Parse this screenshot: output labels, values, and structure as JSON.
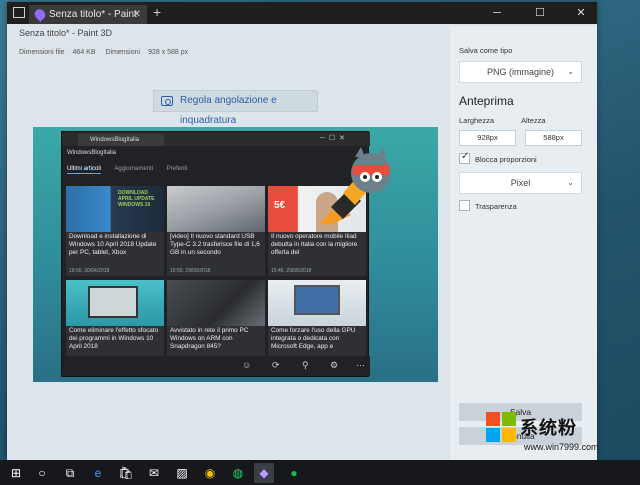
{
  "window": {
    "tab_title": "Senza titolo* - Paint 3D",
    "page_title": "Senza titolo* - Paint 3D",
    "file_size_label": "Dimensioni file",
    "file_size": "464 KB",
    "dimensions_label": "Dimensioni",
    "dimensions": "928 x 588 px"
  },
  "toolbar": {
    "crop_button": "Regola angolazione e inquadratura"
  },
  "preview": {
    "tab_title": "WindowsBlogItalia",
    "header": "WindowsBlogItalia",
    "nav": [
      "Ultimi articoli",
      "Aggiornamenti",
      "Preferiti"
    ],
    "cards": [
      {
        "title": "Download e installazione di Windows 10 April 2018 Update per PC, tablet, Xbox",
        "date": "19:00, 30/04/2018",
        "banner": "DOWNLOAD APRIL UPDATE WINDOWS 10"
      },
      {
        "title": "[video] Il nuovo standard USB Type-C 3.2 trasferisce file di 1,6 GB in un secondo",
        "date": "15:50, 29/09/2018",
        "banner": ""
      },
      {
        "title": "Il nuovo operatore mobile Iliad debutta in Italia con la migliore offerta del",
        "date": "15:45, 29/05/2018",
        "banner": "5€"
      },
      {
        "title": "Come eliminare l'effetto sfocato dei programmi in Windows 10 April 2018",
        "date": "",
        "banner": ""
      },
      {
        "title": "Avvistato in rete il primo PC Windows on ARM con Snapdragon 845?",
        "date": "",
        "banner": ""
      },
      {
        "title": "Come forzare l'uso della GPU integrata o dedicata con Microsoft Edge, app e",
        "date": "",
        "banner": ""
      }
    ]
  },
  "sidebar": {
    "save_type_label": "Salva come tipo",
    "save_type_value": "PNG (immagine)",
    "preview_heading": "Anteprima",
    "width_label": "Larghezza",
    "height_label": "Altezza",
    "width_value": "928px",
    "height_value": "588px",
    "lock_label": "Blocca proporzioni",
    "unit_value": "Pixel",
    "transparency_label": "Trasparenza",
    "save_button": "Salva",
    "cancel_button": "Annulla"
  },
  "watermark": {
    "brand": "系统粉",
    "url": "www.win7999.com"
  },
  "colors": {
    "accent": "#2a5fa8",
    "titlebar": "#1f1f1f",
    "preview_bg": "#2f8c9a"
  }
}
